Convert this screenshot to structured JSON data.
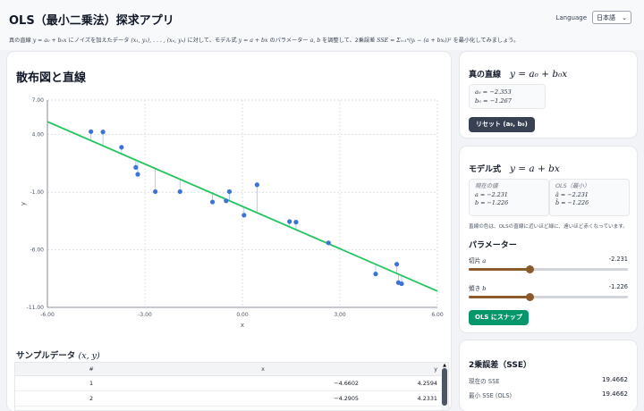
{
  "app": {
    "title": "OLS（最小二乗法）探求アプリ",
    "language_label": "Language",
    "language_value": "日本語"
  },
  "description": {
    "p1": "真の直線 ",
    "m1": "y = a₀ + b₀x",
    "p2": " にノイズを加えたデータ ",
    "m2": "(x₁, y₁), . . . , (xₙ, yₙ)",
    "p3": " に対して、モデル式 ",
    "m3": "y = a + bx",
    "p4": " のパラメーター ",
    "m4": "a, b",
    "p5": " を調整して、2乗誤差 ",
    "m5": "SSE = Σᵢ₌₁ⁿ(yᵢ − (a + bxᵢ))²",
    "p6": " を最小化してみましょう。"
  },
  "chart_section": {
    "title": "散布図と直線"
  },
  "chart_data": {
    "type": "scatter",
    "xlabel": "x",
    "ylabel": "y",
    "xlim": [
      -6,
      6
    ],
    "ylim": [
      -11,
      7
    ],
    "x_ticks": [
      "-6.00",
      "-3.00",
      "0.00",
      "3.00",
      "6.00"
    ],
    "y_ticks": [
      "7.00",
      "4.00",
      "-1.00",
      "-6.00",
      "-11.00"
    ],
    "grid": true,
    "points": [
      {
        "x": -4.6602,
        "y": 4.2594
      },
      {
        "x": -4.2905,
        "y": 4.2331
      },
      {
        "x": -3.72,
        "y": 2.9
      },
      {
        "x": -3.28,
        "y": 1.15
      },
      {
        "x": -3.22,
        "y": 0.55
      },
      {
        "x": -2.68,
        "y": -0.95
      },
      {
        "x": -1.92,
        "y": -0.95
      },
      {
        "x": -0.92,
        "y": -1.85
      },
      {
        "x": -0.5,
        "y": -1.75
      },
      {
        "x": -0.4,
        "y": -0.95
      },
      {
        "x": 0.05,
        "y": -3.0
      },
      {
        "x": 0.45,
        "y": -0.35
      },
      {
        "x": 1.45,
        "y": -3.55
      },
      {
        "x": 1.65,
        "y": -3.6
      },
      {
        "x": 2.65,
        "y": -5.4
      },
      {
        "x": 4.1,
        "y": -8.1
      },
      {
        "x": 4.75,
        "y": -7.25
      },
      {
        "x": 4.8,
        "y": -8.85
      },
      {
        "x": 4.9,
        "y": -8.95
      }
    ],
    "line": {
      "a": -2.231,
      "b": -1.226
    },
    "colors": {
      "points": "#3b73d9",
      "line": "#22c55e",
      "residuals": "#93c5fd"
    }
  },
  "sample_data": {
    "title_prefix": "サンプルデータ ",
    "title_math": "(x, y)",
    "headers": [
      "#",
      "x",
      "y"
    ],
    "rows": [
      {
        "idx": "1",
        "x": "−4.6602",
        "y": "4.2594"
      },
      {
        "idx": "2",
        "x": "−4.2905",
        "y": "4.2331"
      }
    ]
  },
  "true_line": {
    "title": "真の直線",
    "equation": "y = a₀ + b₀x",
    "a0": "a₀ = −2.353",
    "b0": "b₀ = −1.267",
    "reset_label": "リセット (a₀, b₀)"
  },
  "model": {
    "title": "モデル式",
    "equation": "y = a + bx",
    "current_label": "現在の値",
    "current_a": "a = −2.231",
    "current_b": "b = −1.226",
    "ols_label": "OLS（最小）",
    "ols_a": "â = −2.231",
    "ols_b": "b̂ = −1.226",
    "note": "直線の色は、OLSの直線に近いほど緑に、遠いほど赤くなっています。"
  },
  "parameters": {
    "title": "パラメーター",
    "intercept_label": "切片 ",
    "intercept_math": "a",
    "intercept_value": "-2.231",
    "intercept_fraction": 0.385,
    "slope_label": "傾き ",
    "slope_math": "b",
    "slope_value": "-1.226",
    "slope_fraction": 0.385,
    "snap_label": "OLS にスナップ"
  },
  "sse": {
    "title": "2乗誤差（SSE）",
    "current_label": "現在の SSE",
    "current_value": "19.4662",
    "min_label": "最小 SSE (OLS)",
    "min_value": "19.4662"
  }
}
